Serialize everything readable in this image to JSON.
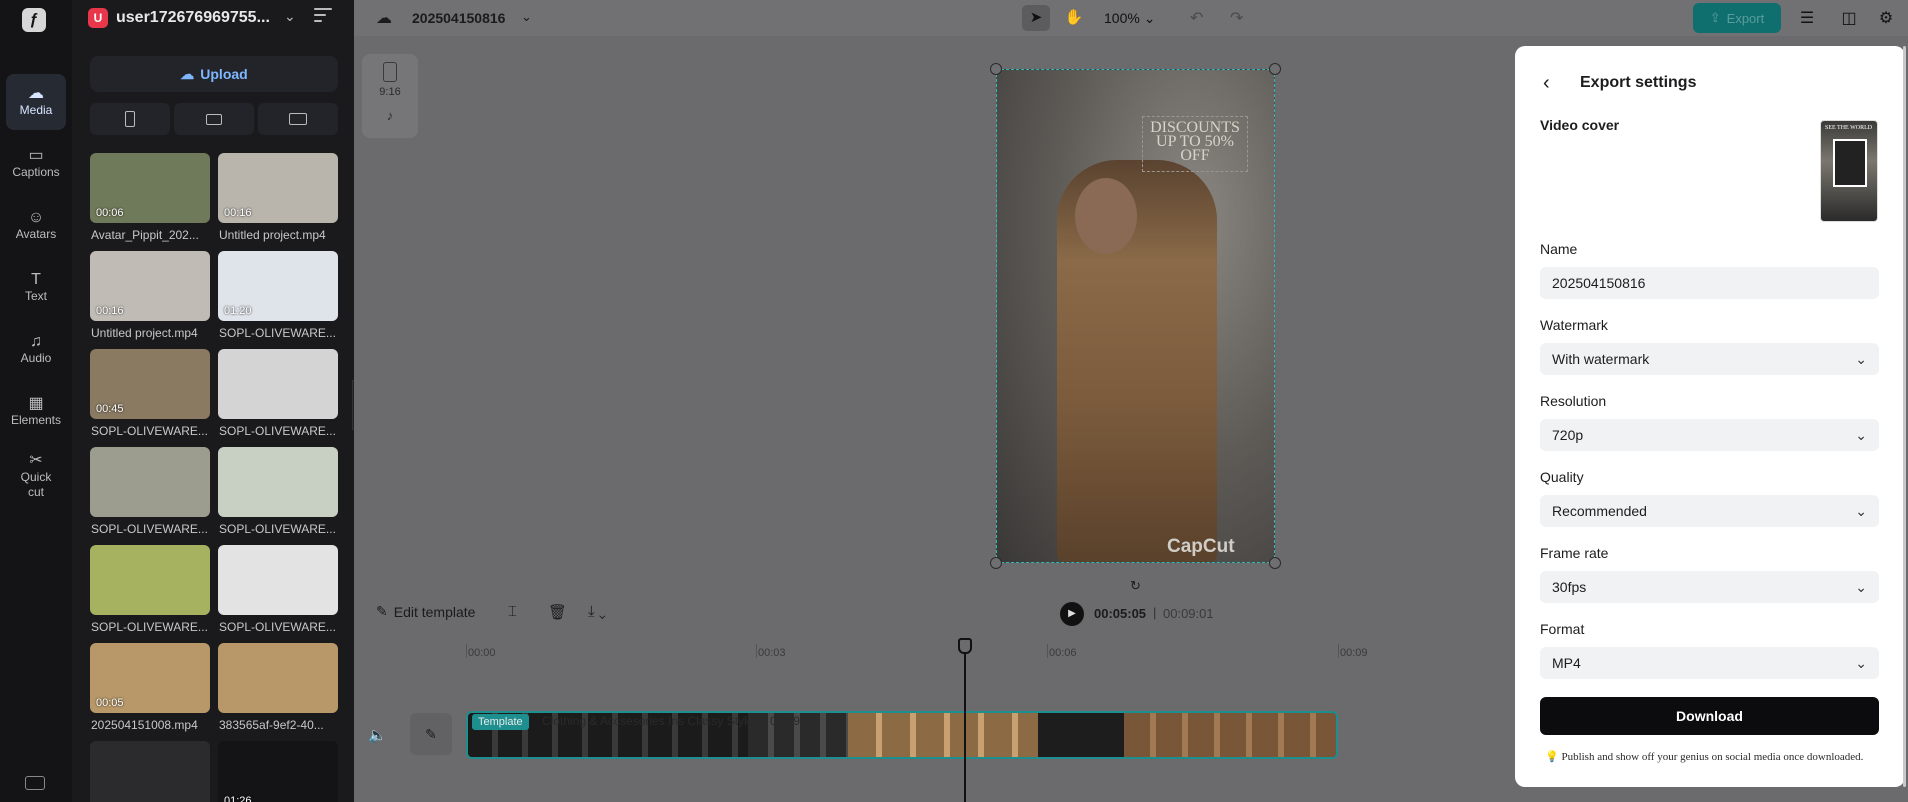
{
  "app": {
    "accent": "#1d8f8f",
    "user_avatar_letter": "U",
    "user_name": "user172676969755...",
    "project_name": "202504150816"
  },
  "rail": {
    "items": [
      {
        "label": "Media",
        "icon": "cloud-icon"
      },
      {
        "label": "Captions",
        "icon": "captions-icon"
      },
      {
        "label": "Avatars",
        "icon": "avatar-icon"
      },
      {
        "label": "Text",
        "icon": "text-icon"
      },
      {
        "label": "Audio",
        "icon": "audio-icon"
      },
      {
        "label": "Elements",
        "icon": "elements-icon"
      },
      {
        "label": "Quick cut",
        "icon": "quick-cut-icon"
      }
    ]
  },
  "media": {
    "upload_label": "Upload",
    "items": [
      {
        "label": "Avatar_Pippit_202...",
        "duration": "00:06",
        "color": "#6f7a5a"
      },
      {
        "label": "Untitled project.mp4",
        "duration": "00:16",
        "color": "#b9b4ac"
      },
      {
        "label": "Untitled project.mp4",
        "duration": "00:16",
        "color": "#c0bcb5"
      },
      {
        "label": "SOPL-OLIVEWARE...",
        "duration": "01:20",
        "color": "#dfe3ea"
      },
      {
        "label": "SOPL-OLIVEWARE...",
        "duration": "00:45",
        "color": "#8a7a62"
      },
      {
        "label": "SOPL-OLIVEWARE...",
        "duration": "",
        "color": "#d4d4d4"
      },
      {
        "label": "SOPL-OLIVEWARE...",
        "duration": "",
        "color": "#9c9c8f"
      },
      {
        "label": "SOPL-OLIVEWARE...",
        "duration": "",
        "color": "#c8d0c4"
      },
      {
        "label": "SOPL-OLIVEWARE...",
        "duration": "",
        "color": "#a7b260"
      },
      {
        "label": "SOPL-OLIVEWARE...",
        "duration": "",
        "color": "#e3e3e3"
      },
      {
        "label": "202504151008.mp4",
        "duration": "00:05",
        "color": "#b89868"
      },
      {
        "label": "383565af-9ef2-40...",
        "duration": "",
        "color": "#b89868"
      },
      {
        "label": "",
        "duration": "",
        "color": "#2b2b2e"
      },
      {
        "label": "",
        "duration": "01:26",
        "color": "#141416"
      }
    ]
  },
  "toolbar": {
    "zoom": "100%",
    "export_label": "Export"
  },
  "ratio": {
    "label": "9:16"
  },
  "canvas": {
    "promo_text": "DISCOUNTS UP TO 50% OFF",
    "watermark": "CapCut"
  },
  "timeline": {
    "edit_template_label": "Edit template",
    "current_time": "00:05:05",
    "separator": "|",
    "total_time": "00:09:01",
    "ruler": [
      "00:00",
      "00:03",
      "00:06",
      "00:09"
    ],
    "track_tag": "Template",
    "track_title": "Clothing & Accsesories Ins Classy Style",
    "track_duration": "00:09:01"
  },
  "export_settings": {
    "title": "Export settings",
    "video_cover_label": "Video cover",
    "cover_caption": "SEE THE WORLD",
    "fields": {
      "name": {
        "label": "Name",
        "value": "202504150816"
      },
      "watermark": {
        "label": "Watermark",
        "value": "With watermark"
      },
      "resolution": {
        "label": "Resolution",
        "value": "720p"
      },
      "quality": {
        "label": "Quality",
        "value": "Recommended"
      },
      "frame_rate": {
        "label": "Frame rate",
        "value": "30fps"
      },
      "format": {
        "label": "Format",
        "value": "MP4"
      }
    },
    "download_label": "Download",
    "tip": "Publish and show off your genius on social media once downloaded."
  }
}
